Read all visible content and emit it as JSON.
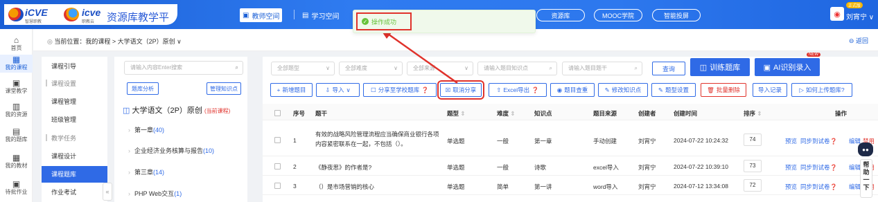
{
  "header": {
    "logo1_text": "iCVE",
    "logo1_sub": "智慧职教",
    "logo2_text": "icve",
    "logo2_sub": "职教云",
    "platform_title": "资源库教学平台",
    "nav": [
      {
        "label": "教师空间",
        "active": true
      },
      {
        "label": "学习空间",
        "active": false
      }
    ],
    "pills": [
      "资源库",
      "MOOC学院",
      "智能投屏"
    ],
    "vip_badge": "正式版",
    "user_name": "刘宵宁",
    "user_chevron": "∨"
  },
  "toast": {
    "text": "操作成功",
    "icon": "check-circle-icon"
  },
  "left_nav": [
    {
      "label": "首页",
      "icon": "home-icon",
      "active": false
    },
    {
      "label": "我的课程",
      "icon": "course-icon",
      "active": true
    },
    {
      "label": "课堂教学",
      "icon": "classroom-icon",
      "active": false
    },
    {
      "label": "我的资源",
      "icon": "resource-icon",
      "active": false
    },
    {
      "label": "我的题库",
      "icon": "question-bank-icon",
      "active": false
    },
    {
      "label": "我的教材",
      "icon": "textbook-icon",
      "active": false
    },
    {
      "label": "待批作业",
      "icon": "homework-icon",
      "active": false
    }
  ],
  "breadcrumb": {
    "text": "当前位置：我的课程 > 大学语文（2P）原创 ∨",
    "back": "返回"
  },
  "sub_sidebar": [
    {
      "label": "课程引导",
      "type": "item",
      "active": false
    },
    {
      "label": "课程设置",
      "type": "group",
      "active": false
    },
    {
      "label": "课程管理",
      "type": "item",
      "active": false
    },
    {
      "label": "班级管理",
      "type": "item",
      "active": false
    },
    {
      "label": "教学任务",
      "type": "group",
      "active": false
    },
    {
      "label": "课程设计",
      "type": "item",
      "active": false
    },
    {
      "label": "课程题库",
      "type": "item",
      "active": true
    },
    {
      "label": "作业考试",
      "type": "item",
      "active": false
    }
  ],
  "collapse_label": "«",
  "tree": {
    "search_placeholder": "请输入内容Enter搜索",
    "btn_analysis": "题库分析",
    "btn_manage": "管理知识点",
    "title": "大学语文（2P）原创",
    "title_tag": "(当前课程)",
    "nodes": [
      {
        "label": "第一章",
        "count": "(40)"
      },
      {
        "label": "企业经济业务核算与报告",
        "count": "(10)"
      },
      {
        "label": "第三章",
        "count": "(14)"
      },
      {
        "label": "PHP Web交互",
        "count": "(1)"
      }
    ]
  },
  "filters": [
    {
      "placeholder": "全部题型"
    },
    {
      "placeholder": "全部难度"
    },
    {
      "placeholder": "全部来源"
    },
    {
      "placeholder": "请输入题目知识点"
    },
    {
      "placeholder": "请输入题目题干"
    }
  ],
  "btn_query": "查询",
  "btn_train": "训练题库",
  "btn_ai": "AI识别录入",
  "new_badge": "NEW",
  "toolbar": [
    {
      "label": "新增题目",
      "icon": "+",
      "style": "normal"
    },
    {
      "label": "导入",
      "icon": "⇩",
      "style": "normal"
    },
    {
      "label": "分享至学校题库",
      "icon": "☐",
      "style": "normal"
    },
    {
      "label": "取消分享",
      "icon": "☒",
      "style": "highlight"
    },
    {
      "label": "Excel导出",
      "icon": "⇧",
      "style": "normal"
    },
    {
      "label": "题目查重",
      "icon": "◉",
      "style": "normal"
    },
    {
      "label": "修改知识点",
      "icon": "✎",
      "style": "normal"
    },
    {
      "label": "题型设置",
      "icon": "✎",
      "style": "normal"
    },
    {
      "label": "批量删除",
      "icon": "🗑",
      "style": "red"
    },
    {
      "label": "导入记录",
      "icon": "",
      "style": "normal"
    },
    {
      "label": "如何上传题库?",
      "icon": "▷",
      "style": "normal"
    }
  ],
  "table": {
    "headers": [
      "序号",
      "题干",
      "题型",
      "难度",
      "知识点",
      "题目来源",
      "创建者",
      "创建时间",
      "排序",
      "操作"
    ],
    "rows": [
      {
        "no": "1",
        "stem": "有效的战略风险管理流程应当确保商业银行各项内容紧密联系在一起，不包括（）。",
        "type": "单选题",
        "difficulty": "一般",
        "knowledge": "第一章",
        "source": "手动创建",
        "creator": "刘宵宁",
        "time": "2024-07-22 10:24:32",
        "order": "74"
      },
      {
        "no": "2",
        "stem": "《静夜思》的作者是?",
        "type": "单选题",
        "difficulty": "一般",
        "knowledge": "诗歌",
        "source": "excel导入",
        "creator": "刘宵宁",
        "time": "2024-07-22 10:39:10",
        "order": "73"
      },
      {
        "no": "3",
        "stem": "（）是市场营销的核心",
        "type": "单选题",
        "difficulty": "简单",
        "knowledge": "第一讲",
        "source": "word导入",
        "creator": "刘宵宁",
        "time": "2024-07-12 13:34:08",
        "order": "72"
      }
    ],
    "ops": [
      "预览",
      "同步到试卷",
      "编辑",
      "禁用"
    ]
  },
  "help_tab": "帮助一下",
  "colors": {
    "accent": "#2f6ae6",
    "danger": "#e0322b",
    "success": "#67c23a"
  }
}
